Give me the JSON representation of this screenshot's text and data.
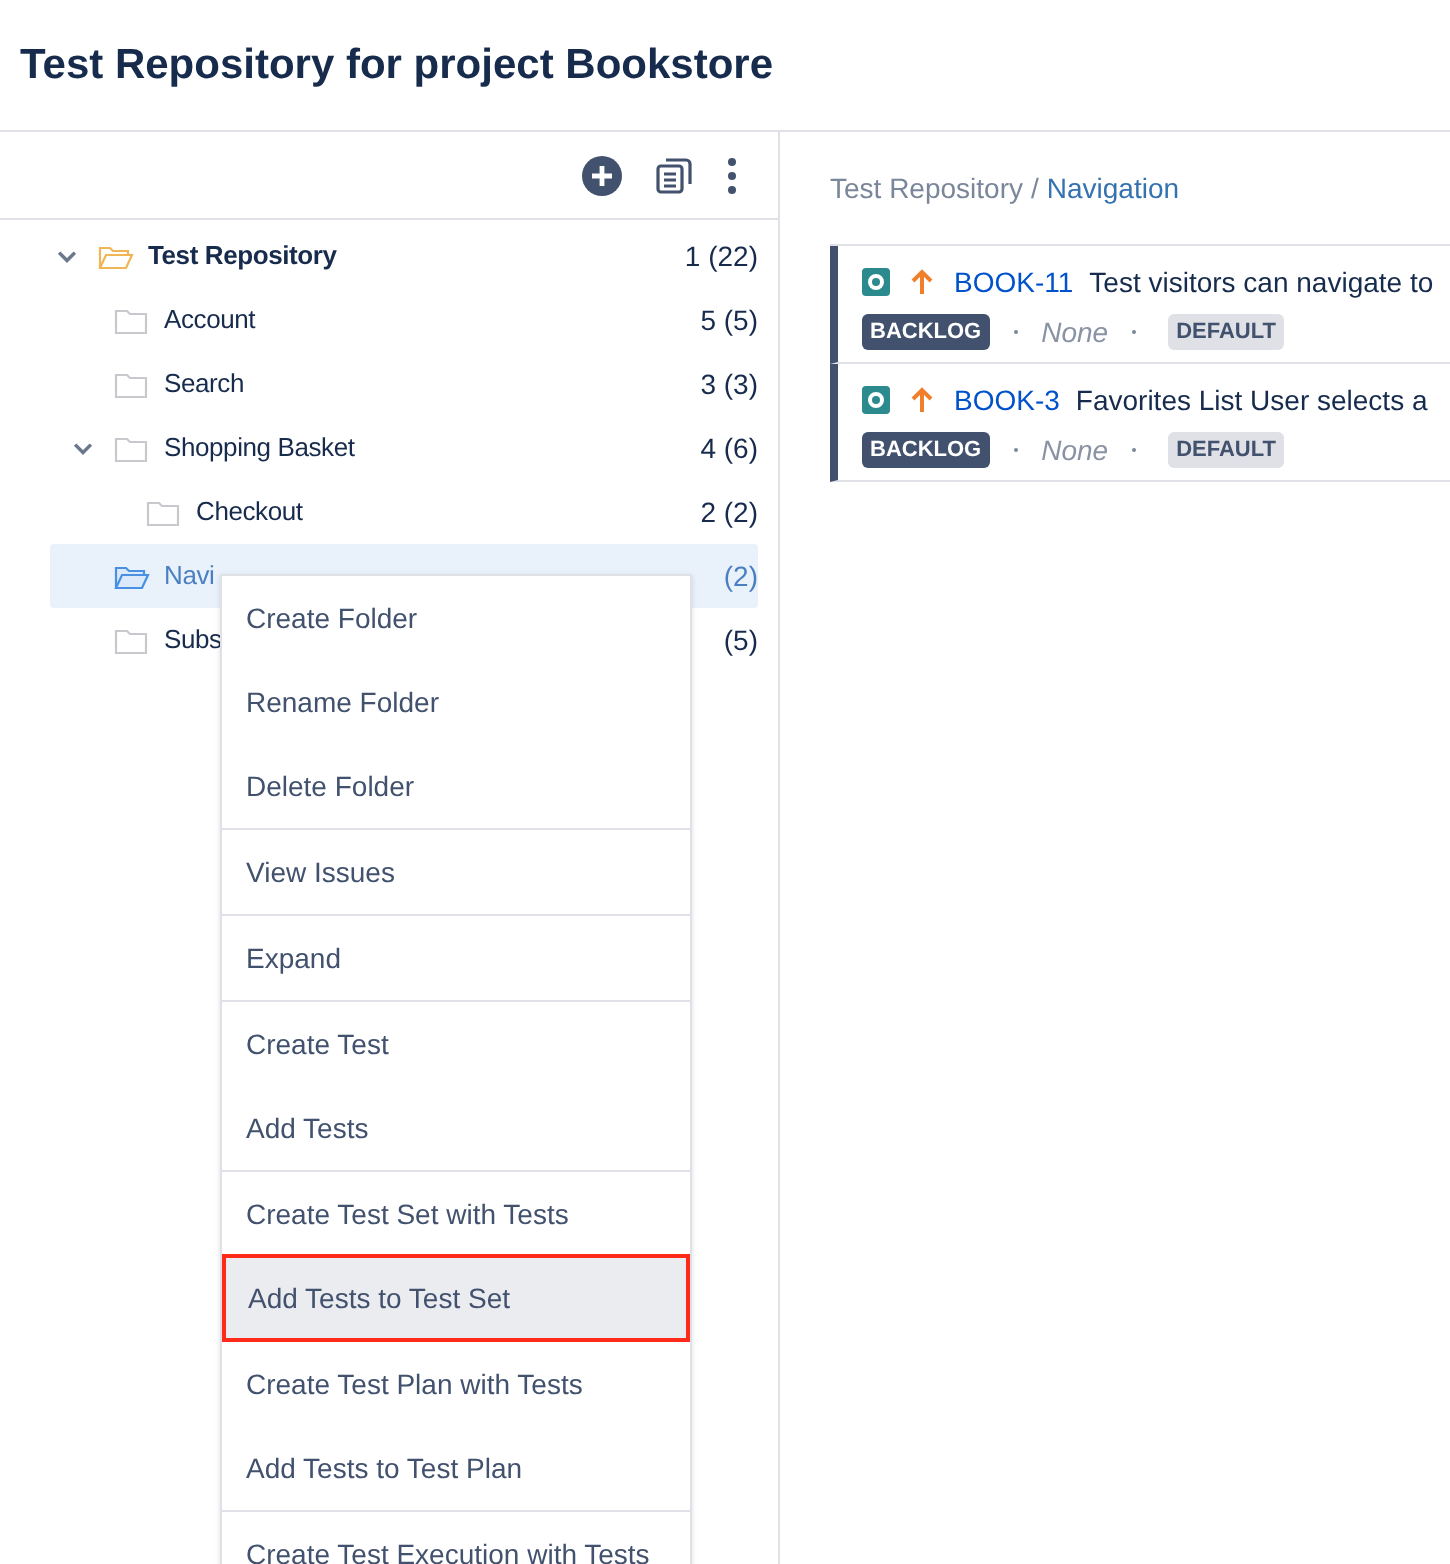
{
  "page_title": "Test Repository for project Bookstore",
  "tree": [
    {
      "label": "Test Repository",
      "count": "1 (22)",
      "expanded": true,
      "selected": false,
      "children": [
        {
          "label": "Account",
          "count": "5 (5)",
          "selected": false
        },
        {
          "label": "Search",
          "count": "3 (3)",
          "selected": false
        },
        {
          "label": "Shopping Basket",
          "count": "4 (6)",
          "expanded": true,
          "selected": false,
          "children": [
            {
              "label": "Checkout",
              "count": "2 (2)",
              "selected": false
            }
          ]
        },
        {
          "label": "Navi",
          "count": "(2)",
          "selected": true
        },
        {
          "label": "Subs",
          "count": "(5)",
          "selected": false
        }
      ]
    }
  ],
  "breadcrumb": {
    "parent": "Test Repository",
    "separator": "/",
    "current": "Navigation"
  },
  "tests": [
    {
      "key": "BOOK-11",
      "summary": "Test visitors can navigate to",
      "status": "BACKLOG",
      "assignee": "None",
      "label": "DEFAULT"
    },
    {
      "key": "BOOK-3",
      "summary": "Favorites List User selects a",
      "status": "BACKLOG",
      "assignee": "None",
      "label": "DEFAULT"
    }
  ],
  "context_menu": {
    "groups": [
      [
        {
          "label": "Create Folder",
          "selected": false
        },
        {
          "label": "Rename Folder",
          "selected": false
        },
        {
          "label": "Delete Folder",
          "selected": false
        }
      ],
      [
        {
          "label": "View Issues",
          "selected": false
        }
      ],
      [
        {
          "label": "Expand",
          "selected": false
        }
      ],
      [
        {
          "label": "Create Test",
          "selected": false
        },
        {
          "label": "Add Tests",
          "selected": false
        }
      ],
      [
        {
          "label": "Create Test Set with Tests",
          "selected": false
        },
        {
          "label": "Add Tests to Test Set",
          "selected": true
        }
      ],
      [
        {
          "label": "Create Test Plan with Tests",
          "selected": false
        },
        {
          "label": "Add Tests to Test Plan",
          "selected": false
        }
      ],
      [
        {
          "label": "Create Test Execution with Tests",
          "selected": false
        }
      ]
    ]
  }
}
